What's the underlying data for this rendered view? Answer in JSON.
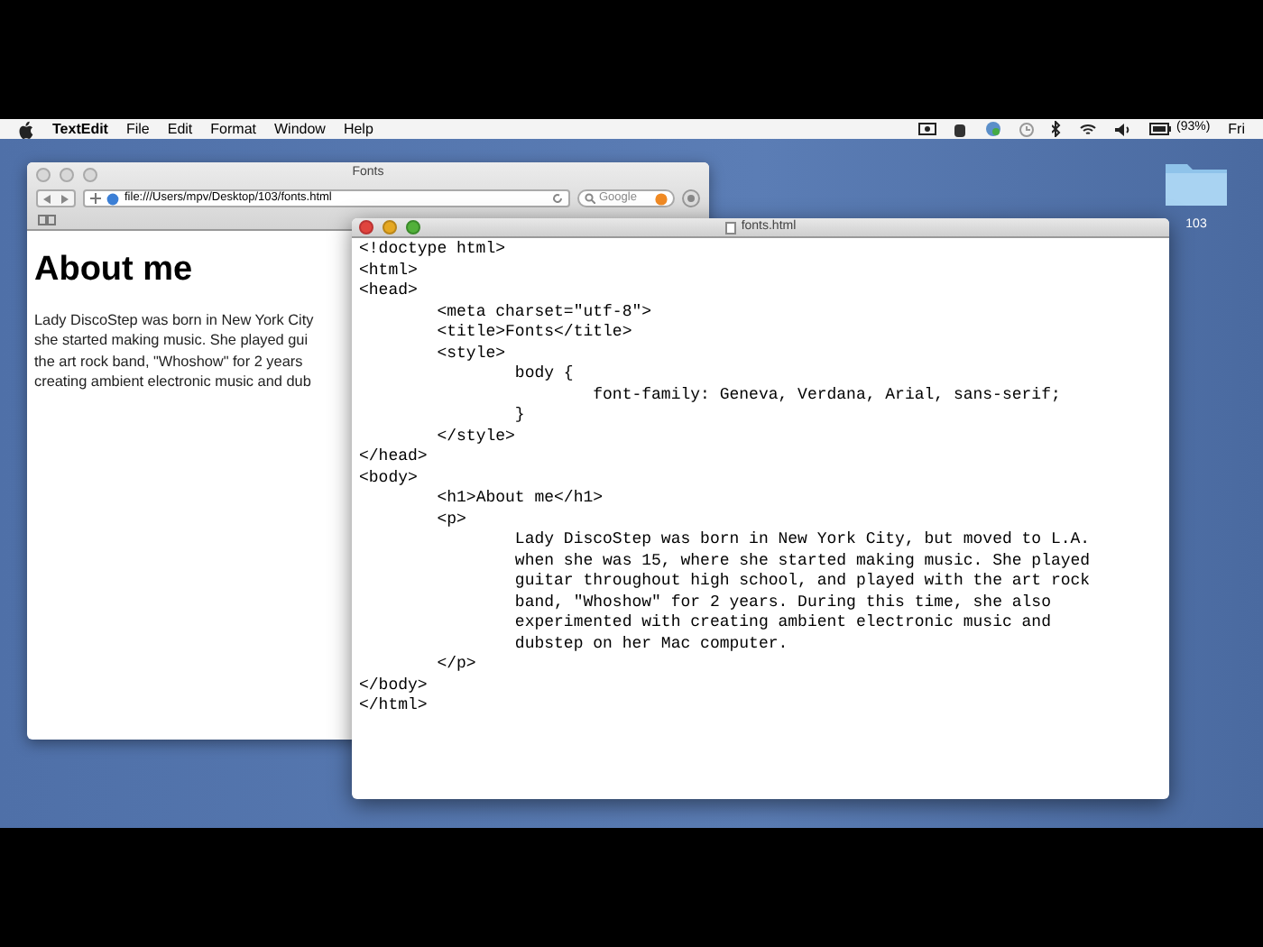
{
  "menu_bar": {
    "app_name": "TextEdit",
    "items": [
      "File",
      "Edit",
      "Format",
      "Window",
      "Help"
    ],
    "battery": "(93%)",
    "clock": "Fri"
  },
  "desktop": {
    "folder_label": "103"
  },
  "browser": {
    "title": "Fonts",
    "address": "file:///Users/mpv/Desktop/103/fonts.html",
    "search_placeholder": "Google",
    "heading": "About me",
    "paragraph_lines": [
      "Lady DiscoStep was born in New York City",
      "she started making music. She played gui",
      "the art rock band, \"Whoshow\" for 2 years",
      "creating ambient electronic music and dub"
    ]
  },
  "editor": {
    "title": "fonts.html",
    "lines": [
      "<!doctype html>",
      "<html>",
      "<head>",
      "\t<meta charset=\"utf-8\">",
      "\t<title>Fonts</title>",
      "\t<style>",
      "\t\tbody {",
      "\t\t\tfont-family: Geneva, Verdana, Arial, sans-serif;",
      "\t\t}",
      "\t</style>",
      "</head>",
      "<body>",
      "\t<h1>About me</h1>",
      "\t<p>",
      "\t\tLady DiscoStep was born in New York City, but moved to L.A.",
      "\t\twhen she was 15, where she started making music. She played",
      "\t\tguitar throughout high school, and played with the art rock",
      "\t\tband, \"Whoshow\" for 2 years. During this time, she also",
      "\t\texperimented with creating ambient electronic music and",
      "\t\tdubstep on her Mac computer.",
      "\t</p>",
      "</body>",
      "</html>"
    ]
  }
}
